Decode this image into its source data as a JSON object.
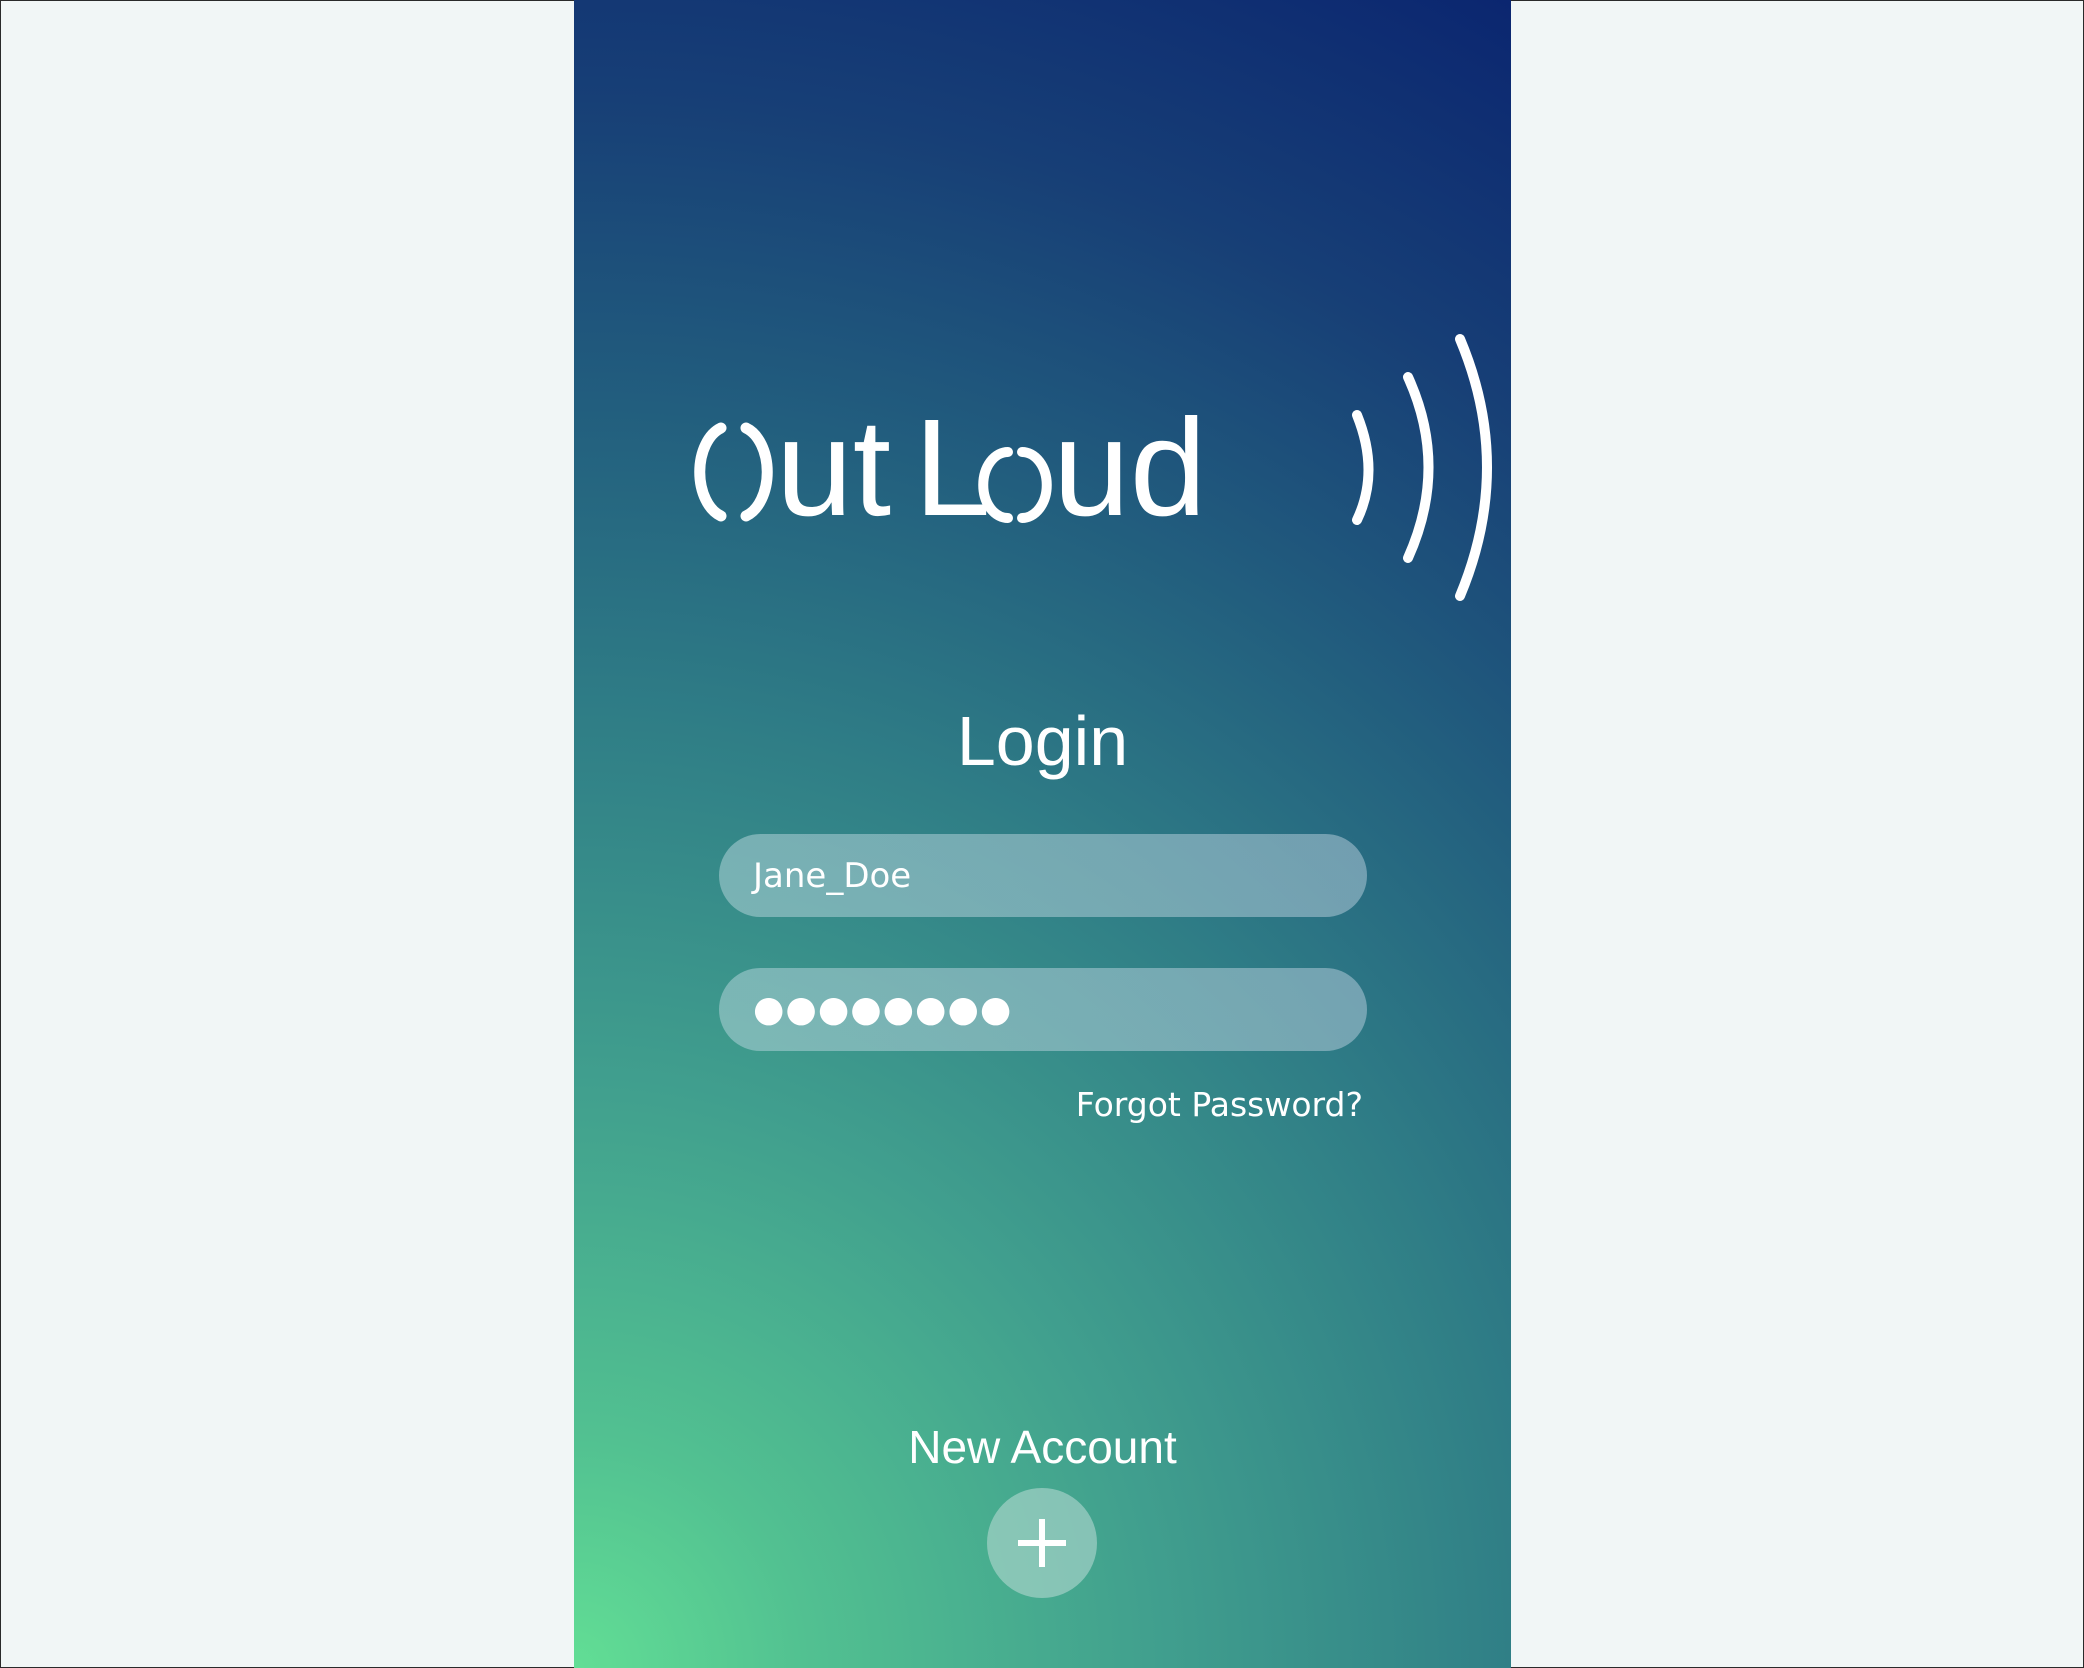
{
  "app": {
    "logo_text": "OutLoud"
  },
  "login": {
    "title": "Login",
    "username_value": "Jane_Doe",
    "password_mask": "●●●●●●●●",
    "forgot_label": "Forgot Password?"
  },
  "new_account": {
    "label": "New Account",
    "button_icon": "plus-icon"
  },
  "colors": {
    "gradient_top": "#0b2670",
    "gradient_bottom_left": "#62de95",
    "text": "#ffffff",
    "page_background": "#f1f6f6"
  }
}
